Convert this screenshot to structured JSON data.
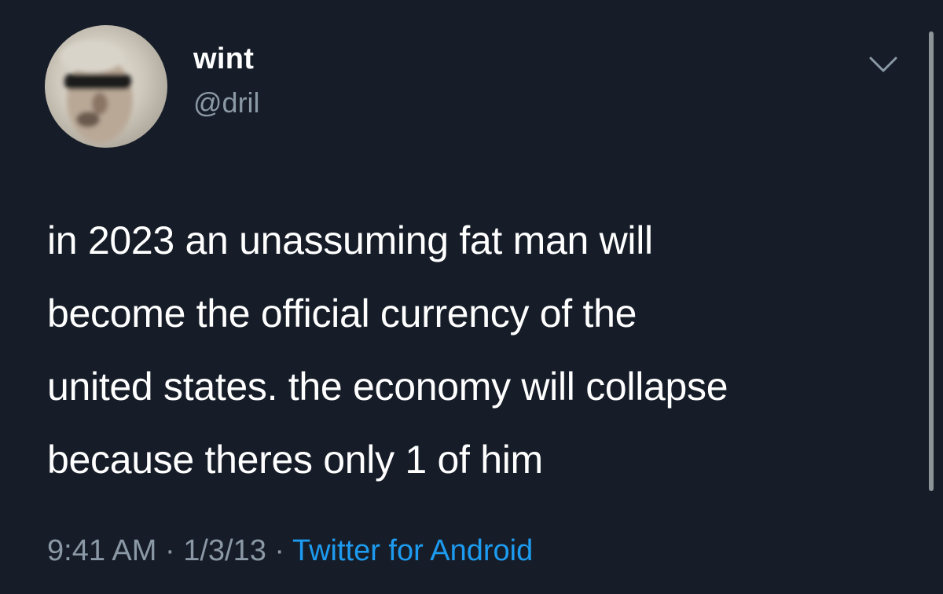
{
  "author": {
    "display_name": "wint",
    "handle": "@dril"
  },
  "tweet": {
    "lines": [
      "in 2023 an unassuming fat man will",
      "become the official currency of the",
      "united states. the economy will collapse",
      "because theres only 1 of him"
    ]
  },
  "meta": {
    "time": "9:41 AM",
    "separator1": " · ",
    "date": "1/3/13",
    "separator2": " · ",
    "source": "Twitter for Android"
  },
  "icons": {
    "menu": "chevron-down-icon"
  },
  "colors": {
    "background": "#161d28",
    "text": "#ffffff",
    "secondary": "#8b98a5",
    "link": "#1d9bf0"
  }
}
